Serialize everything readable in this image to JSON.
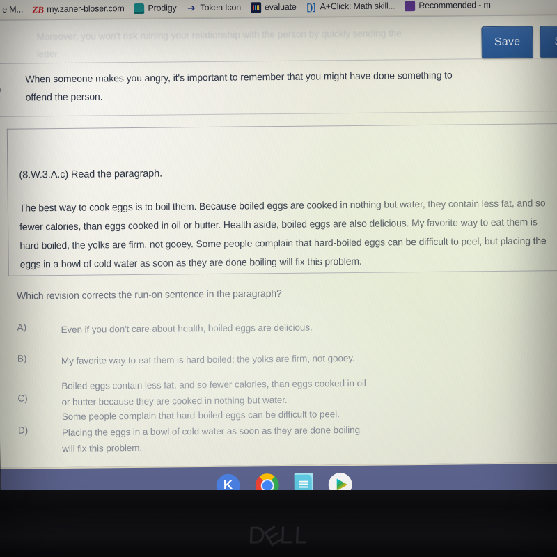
{
  "browser": {
    "bookmarks": [
      {
        "label": "e M...",
        "icon": "bookmark-folder-icon"
      },
      {
        "label": "my.zaner-bloser.com",
        "icon": "zaner-bloser-icon"
      },
      {
        "label": "Prodigy",
        "icon": "prodigy-icon"
      },
      {
        "label": "Token Icon",
        "icon": "cursor-icon"
      },
      {
        "label": "evaluate",
        "icon": "evaluate-icon"
      },
      {
        "label": "A+Click: Math skill...",
        "icon": "aplusclick-icon"
      },
      {
        "label": "Recommended - m",
        "icon": "recommended-icon"
      }
    ]
  },
  "toolbar": {
    "save_label": "Save",
    "submit_label": "Su",
    "button_color": "#2f5f9e"
  },
  "previous_question": {
    "faded_text": "Moreover, you won't risk ruining your relationship with the person by quickly sending the letter.",
    "choice_letter": "D)",
    "choice_text": "When someone makes you angry, it's important to remember that you might have done something to offend the person."
  },
  "question": {
    "standard_code": "(8.W.3.A.c) Read the paragraph.",
    "passage": "The best way to cook eggs is to boil them. Because boiled eggs are cooked in nothing but water, they contain less fat, and so fewer calories, than eggs cooked in oil or butter. Health aside, boiled eggs are also delicious. My favorite way to eat them is hard boiled, the yolks are firm, not gooey. Some people complain that hard-boiled eggs can be difficult to peel, but placing the eggs in a bowl of cold water as soon as they are done boiling will fix this problem.",
    "stem": "Which revision corrects the run-on sentence in the paragraph?",
    "options": [
      {
        "letter": "A)",
        "text": "Even if you don't care about health, boiled eggs are delicious."
      },
      {
        "letter": "B)",
        "text": "My favorite way to eat them is hard boiled; the yolks are firm, not gooey."
      },
      {
        "letter": "C)",
        "text": "Boiled eggs contain less fat, and so fewer calories, than eggs cooked in oil or butter because they are cooked in nothing but water."
      },
      {
        "letter": "D)",
        "text": "Some people complain that hard-boiled eggs can be difficult to peel. Placing the eggs in a bowl of cold water as soon as they are done boiling will fix this problem."
      }
    ]
  },
  "shelf": {
    "background_color": "#5b628c",
    "items": [
      {
        "name": "kahoot-icon",
        "glyph": "K"
      },
      {
        "name": "chrome-icon",
        "glyph": ""
      },
      {
        "name": "google-docs-icon",
        "glyph": ""
      },
      {
        "name": "play-store-icon",
        "glyph": ""
      }
    ]
  },
  "device": {
    "brand": "DELL"
  }
}
